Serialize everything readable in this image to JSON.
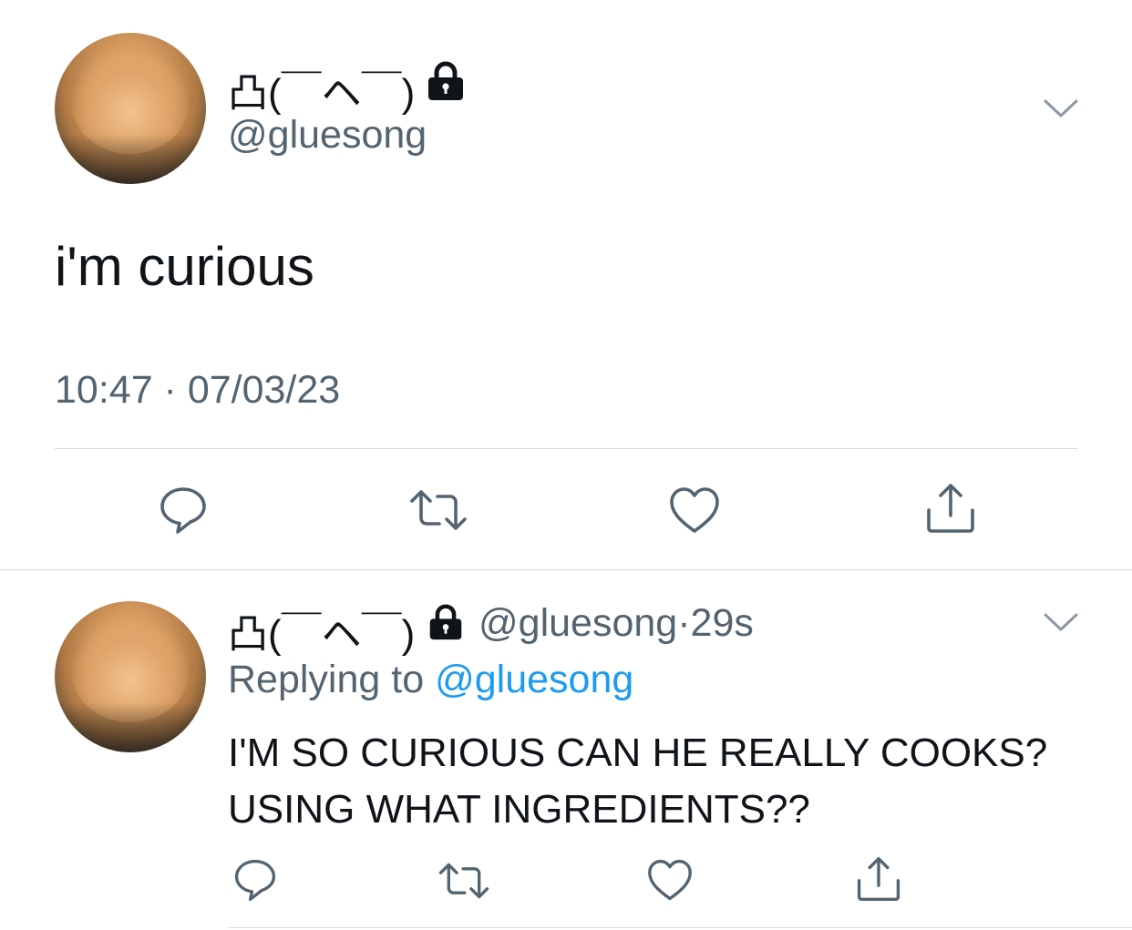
{
  "main_tweet": {
    "display_name": "凸(￣ヘ￣)",
    "handle": "@gluesong",
    "text": "i'm curious",
    "timestamp": "10:47 · 07/03/23"
  },
  "reply_tweet": {
    "display_name": "凸(￣ヘ￣)",
    "handle": "@gluesong",
    "separator": "·",
    "age": "29s",
    "replying_prefix": "Replying to ",
    "replying_mention": "@gluesong",
    "text": "I'M SO CURIOUS CAN HE REALLY COOKS? USING WHAT INGREDIENTS??"
  },
  "icons": {
    "lock": "lock-icon",
    "more": "chevron-down-icon",
    "reply": "reply-icon",
    "retweet": "retweet-icon",
    "like": "heart-icon",
    "share": "share-icon"
  },
  "colors": {
    "text": "#0f1419",
    "secondary": "#536471",
    "link": "#1d9bf0",
    "divider": "#d6dbe0"
  }
}
